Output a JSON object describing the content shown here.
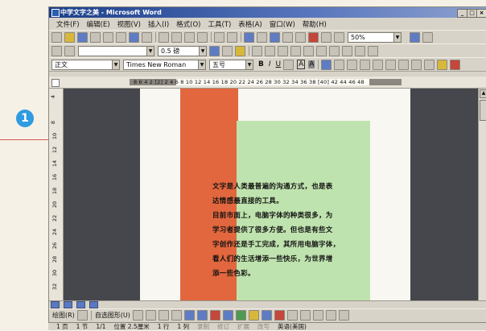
{
  "callout": {
    "number": "1"
  },
  "window": {
    "title": "中学文字之美 - Microsoft Word",
    "buttons": {
      "minimize": "_",
      "maximize": "□",
      "close": "×"
    }
  },
  "menu": {
    "items": [
      "文件(F)",
      "编辑(E)",
      "视图(V)",
      "插入(I)",
      "格式(O)",
      "工具(T)",
      "表格(A)",
      "窗口(W)",
      "帮助(H)"
    ],
    "close": "×"
  },
  "toolbar_standard": {
    "zoom": "50%"
  },
  "toolbar_drawing_line": {
    "line_weight": "0.5 磅"
  },
  "toolbar_format": {
    "style": "正文",
    "font": "Times New Roman",
    "size": "五号",
    "bold": "B",
    "italic": "I",
    "underline": "U",
    "char_border": "A",
    "char_shading": "A"
  },
  "ruler": {
    "numbers": "8  6  4  2  [2]  2   4   6   8  10 12 14 16 18 20 22 24 26 28 30 32 34 36 38  [40] 42  44  46  48",
    "vertical": [
      "4",
      "8",
      "10",
      "12",
      "14",
      "16",
      "18",
      "20",
      "22",
      "24",
      "26",
      "28",
      "30",
      "32",
      "34",
      "36"
    ]
  },
  "document": {
    "lines": [
      "文字是人类最普遍的沟通方式，也是表",
      "达情感最直接的工具。",
      "目前市面上，电脑字体的种类很多，为",
      "学习者提供了很多方便。但也是有些文",
      "字创作还是手工完成，其所用电脑字体，",
      "看人们的生活增添一些快乐，为世界增",
      "添一些色彩。"
    ]
  },
  "drawbar": {
    "draw": "绘图(R)",
    "autoshapes": "自选图形(U)"
  },
  "statusbar": {
    "page": "1 页",
    "section": "1 节",
    "page_of": "1/1",
    "position": "位置 2.5厘米",
    "line": "1 行",
    "column": "1 列",
    "rec": "录制",
    "trk": "修订",
    "ext": "扩展",
    "ovr": "改写",
    "lang": "英语(美国)"
  }
}
